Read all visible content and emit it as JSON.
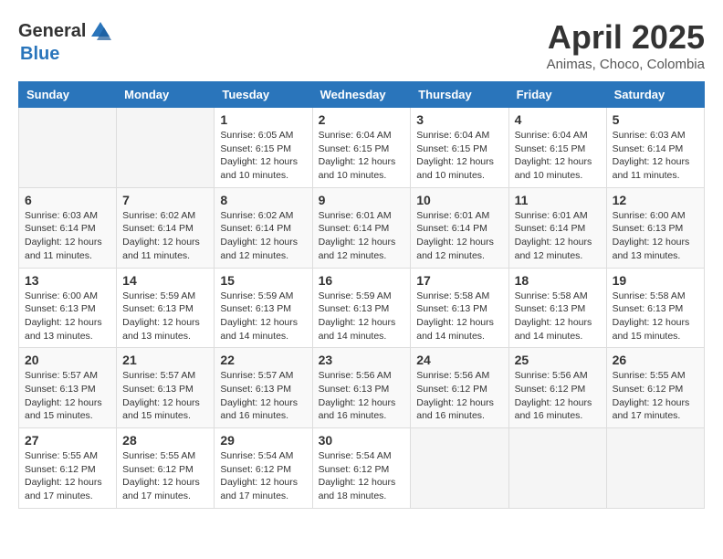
{
  "header": {
    "logo_general": "General",
    "logo_blue": "Blue",
    "month": "April 2025",
    "location": "Animas, Choco, Colombia"
  },
  "weekdays": [
    "Sunday",
    "Monday",
    "Tuesday",
    "Wednesday",
    "Thursday",
    "Friday",
    "Saturday"
  ],
  "weeks": [
    [
      {
        "day": "",
        "info": ""
      },
      {
        "day": "",
        "info": ""
      },
      {
        "day": "1",
        "info": "Sunrise: 6:05 AM\nSunset: 6:15 PM\nDaylight: 12 hours and 10 minutes."
      },
      {
        "day": "2",
        "info": "Sunrise: 6:04 AM\nSunset: 6:15 PM\nDaylight: 12 hours and 10 minutes."
      },
      {
        "day": "3",
        "info": "Sunrise: 6:04 AM\nSunset: 6:15 PM\nDaylight: 12 hours and 10 minutes."
      },
      {
        "day": "4",
        "info": "Sunrise: 6:04 AM\nSunset: 6:15 PM\nDaylight: 12 hours and 10 minutes."
      },
      {
        "day": "5",
        "info": "Sunrise: 6:03 AM\nSunset: 6:14 PM\nDaylight: 12 hours and 11 minutes."
      }
    ],
    [
      {
        "day": "6",
        "info": "Sunrise: 6:03 AM\nSunset: 6:14 PM\nDaylight: 12 hours and 11 minutes."
      },
      {
        "day": "7",
        "info": "Sunrise: 6:02 AM\nSunset: 6:14 PM\nDaylight: 12 hours and 11 minutes."
      },
      {
        "day": "8",
        "info": "Sunrise: 6:02 AM\nSunset: 6:14 PM\nDaylight: 12 hours and 12 minutes."
      },
      {
        "day": "9",
        "info": "Sunrise: 6:01 AM\nSunset: 6:14 PM\nDaylight: 12 hours and 12 minutes."
      },
      {
        "day": "10",
        "info": "Sunrise: 6:01 AM\nSunset: 6:14 PM\nDaylight: 12 hours and 12 minutes."
      },
      {
        "day": "11",
        "info": "Sunrise: 6:01 AM\nSunset: 6:14 PM\nDaylight: 12 hours and 12 minutes."
      },
      {
        "day": "12",
        "info": "Sunrise: 6:00 AM\nSunset: 6:13 PM\nDaylight: 12 hours and 13 minutes."
      }
    ],
    [
      {
        "day": "13",
        "info": "Sunrise: 6:00 AM\nSunset: 6:13 PM\nDaylight: 12 hours and 13 minutes."
      },
      {
        "day": "14",
        "info": "Sunrise: 5:59 AM\nSunset: 6:13 PM\nDaylight: 12 hours and 13 minutes."
      },
      {
        "day": "15",
        "info": "Sunrise: 5:59 AM\nSunset: 6:13 PM\nDaylight: 12 hours and 14 minutes."
      },
      {
        "day": "16",
        "info": "Sunrise: 5:59 AM\nSunset: 6:13 PM\nDaylight: 12 hours and 14 minutes."
      },
      {
        "day": "17",
        "info": "Sunrise: 5:58 AM\nSunset: 6:13 PM\nDaylight: 12 hours and 14 minutes."
      },
      {
        "day": "18",
        "info": "Sunrise: 5:58 AM\nSunset: 6:13 PM\nDaylight: 12 hours and 14 minutes."
      },
      {
        "day": "19",
        "info": "Sunrise: 5:58 AM\nSunset: 6:13 PM\nDaylight: 12 hours and 15 minutes."
      }
    ],
    [
      {
        "day": "20",
        "info": "Sunrise: 5:57 AM\nSunset: 6:13 PM\nDaylight: 12 hours and 15 minutes."
      },
      {
        "day": "21",
        "info": "Sunrise: 5:57 AM\nSunset: 6:13 PM\nDaylight: 12 hours and 15 minutes."
      },
      {
        "day": "22",
        "info": "Sunrise: 5:57 AM\nSunset: 6:13 PM\nDaylight: 12 hours and 16 minutes."
      },
      {
        "day": "23",
        "info": "Sunrise: 5:56 AM\nSunset: 6:13 PM\nDaylight: 12 hours and 16 minutes."
      },
      {
        "day": "24",
        "info": "Sunrise: 5:56 AM\nSunset: 6:12 PM\nDaylight: 12 hours and 16 minutes."
      },
      {
        "day": "25",
        "info": "Sunrise: 5:56 AM\nSunset: 6:12 PM\nDaylight: 12 hours and 16 minutes."
      },
      {
        "day": "26",
        "info": "Sunrise: 5:55 AM\nSunset: 6:12 PM\nDaylight: 12 hours and 17 minutes."
      }
    ],
    [
      {
        "day": "27",
        "info": "Sunrise: 5:55 AM\nSunset: 6:12 PM\nDaylight: 12 hours and 17 minutes."
      },
      {
        "day": "28",
        "info": "Sunrise: 5:55 AM\nSunset: 6:12 PM\nDaylight: 12 hours and 17 minutes."
      },
      {
        "day": "29",
        "info": "Sunrise: 5:54 AM\nSunset: 6:12 PM\nDaylight: 12 hours and 17 minutes."
      },
      {
        "day": "30",
        "info": "Sunrise: 5:54 AM\nSunset: 6:12 PM\nDaylight: 12 hours and 18 minutes."
      },
      {
        "day": "",
        "info": ""
      },
      {
        "day": "",
        "info": ""
      },
      {
        "day": "",
        "info": ""
      }
    ]
  ]
}
